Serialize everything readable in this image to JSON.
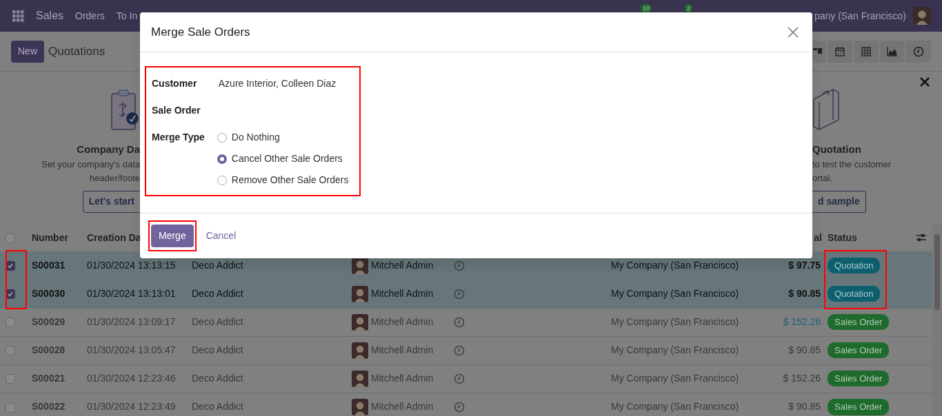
{
  "navbar": {
    "app": "Sales",
    "menu": [
      "Orders",
      "To In"
    ],
    "badges": [
      "10",
      "2"
    ],
    "company": "pany (San Francisco)"
  },
  "control_panel": {
    "new_button": "New",
    "title": "Quotations"
  },
  "banner": {
    "left": {
      "title": "Company Da",
      "lines": [
        "Set your company's data",
        "header/foote"
      ],
      "button": "Let's start"
    },
    "right": {
      "title": "Quotation",
      "lines": [
        "to test the customer",
        "ortal."
      ],
      "button": "d sample"
    }
  },
  "table": {
    "columns": {
      "number": "Number",
      "creation_date": "Creation Da",
      "total": "al",
      "status": "Status"
    },
    "all_checked": false,
    "rows": [
      {
        "selected": true,
        "number": "S00031",
        "date": "01/30/2024 13:13:15",
        "customer": "Deco Addict",
        "salesperson": "Mitchell Admin",
        "company": "My Company (San Francisco)",
        "total": "$ 97.75",
        "total_highlighted": false,
        "status": "Quotation",
        "confirmed": false
      },
      {
        "selected": true,
        "number": "S00030",
        "date": "01/30/2024 13:13:01",
        "customer": "Deco Addict",
        "salesperson": "Mitchell Admin",
        "company": "My Company (San Francisco)",
        "total": "$ 90.85",
        "total_highlighted": false,
        "status": "Quotation",
        "confirmed": false
      },
      {
        "selected": false,
        "number": "S00029",
        "date": "01/30/2024 13:09:17",
        "customer": "Deco Addict",
        "salesperson": "Mitchell Admin",
        "company": "My Company (San Francisco)",
        "total": "$ 152.26",
        "total_highlighted": true,
        "status": "Sales Order",
        "confirmed": true
      },
      {
        "selected": false,
        "number": "S00028",
        "date": "01/30/2024 13:05:47",
        "customer": "Deco Addict",
        "salesperson": "Mitchell Admin",
        "company": "My Company (San Francisco)",
        "total": "$ 90.85",
        "total_highlighted": false,
        "status": "Sales Order",
        "confirmed": true
      },
      {
        "selected": false,
        "number": "S00021",
        "date": "01/30/2024 12:23:46",
        "customer": "Deco Addict",
        "salesperson": "Mitchell Admin",
        "company": "My Company (San Francisco)",
        "total": "$ 152.26",
        "total_highlighted": false,
        "status": "Sales Order",
        "confirmed": true
      },
      {
        "selected": false,
        "number": "S00022",
        "date": "01/30/2024 12:23:49",
        "customer": "Deco Addict",
        "salesperson": "Mitchell Admin",
        "company": "My Company (San Francisco)",
        "total": "$ 90.85",
        "total_highlighted": false,
        "status": "Sales Order",
        "confirmed": true
      }
    ]
  },
  "dialog": {
    "title": "Merge Sale Orders",
    "fields": [
      {
        "label": "Customer",
        "value": "Azure Interior, Colleen Diaz"
      },
      {
        "label": "Sale Order"
      }
    ],
    "merge_type": {
      "label": "Merge Type",
      "options": [
        {
          "label": "Do Nothing",
          "selected": false
        },
        {
          "label": "Cancel Other Sale Orders",
          "selected": true
        },
        {
          "label": "Remove Other Sale Orders",
          "selected": false
        }
      ]
    },
    "buttons": {
      "primary": "Merge",
      "secondary": "Cancel"
    }
  },
  "highlights": {
    "form": true,
    "merge_button": true,
    "row_checkboxes": true,
    "row_statuses": true
  }
}
